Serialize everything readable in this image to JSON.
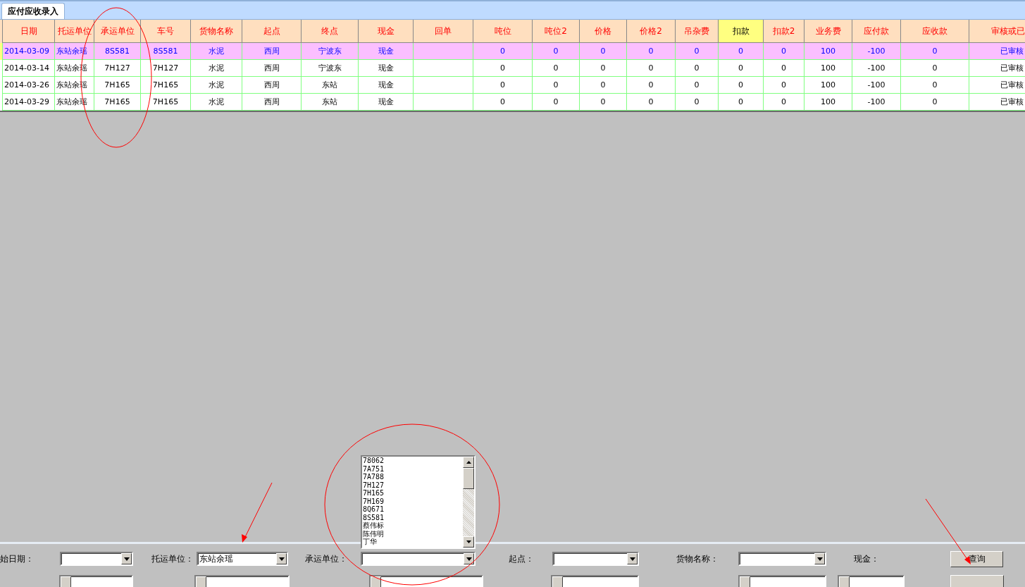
{
  "tab": {
    "label": "应付应收录入",
    "selected": true
  },
  "table": {
    "columns": [
      {
        "label": "日期",
        "highlighted": false
      },
      {
        "label": "托运单位",
        "highlighted": false
      },
      {
        "label": "承运单位",
        "highlighted": false
      },
      {
        "label": "车号",
        "highlighted": false
      },
      {
        "label": "货物名称",
        "highlighted": false
      },
      {
        "label": "起点",
        "highlighted": false
      },
      {
        "label": "终点",
        "highlighted": false
      },
      {
        "label": "现金",
        "highlighted": false
      },
      {
        "label": "回单",
        "highlighted": false
      },
      {
        "label": "吨位",
        "highlighted": false
      },
      {
        "label": "吨位2",
        "highlighted": false
      },
      {
        "label": "价格",
        "highlighted": false
      },
      {
        "label": "价格2",
        "highlighted": false
      },
      {
        "label": "吊杂费",
        "highlighted": false
      },
      {
        "label": "扣款",
        "highlighted": true
      },
      {
        "label": "扣款2",
        "highlighted": false
      },
      {
        "label": "业务费",
        "highlighted": false
      },
      {
        "label": "应付款",
        "highlighted": false
      },
      {
        "label": "应收款",
        "highlighted": false
      },
      {
        "label": "审核或已",
        "highlighted": false
      }
    ],
    "rows": [
      {
        "selected": true,
        "cells": [
          "2014-03-09",
          "东站余瑶",
          "8S581",
          "8S581",
          "水泥",
          "西周",
          "宁波东",
          "现金",
          "",
          "0",
          "0",
          "0",
          "0",
          "0",
          "0",
          "0",
          "100",
          "-100",
          "0",
          "已审核"
        ]
      },
      {
        "selected": false,
        "cells": [
          "2014-03-14",
          "东站余瑶",
          "7H127",
          "7H127",
          "水泥",
          "西周",
          "宁波东",
          "现金",
          "",
          "0",
          "0",
          "0",
          "0",
          "0",
          "0",
          "0",
          "100",
          "-100",
          "0",
          "已审核"
        ]
      },
      {
        "selected": false,
        "cells": [
          "2014-03-26",
          "东站余瑶",
          "7H165",
          "7H165",
          "水泥",
          "西周",
          "东站",
          "现金",
          "",
          "0",
          "0",
          "0",
          "0",
          "0",
          "0",
          "0",
          "100",
          "-100",
          "0",
          "已审核"
        ]
      },
      {
        "selected": false,
        "cells": [
          "2014-03-29",
          "东站余瑶",
          "7H165",
          "7H165",
          "水泥",
          "西周",
          "东站",
          "现金",
          "",
          "0",
          "0",
          "0",
          "0",
          "0",
          "0",
          "0",
          "100",
          "-100",
          "0",
          "已审核"
        ]
      }
    ]
  },
  "filters": [
    {
      "label": "始日期：",
      "kind": "combo",
      "open": false
    },
    {
      "label": "托运单位：",
      "kind": "combo",
      "open": false,
      "value": "东站余瑶"
    },
    {
      "label": "承运单位：",
      "kind": "combo",
      "open": true,
      "dropdown_items": [
        "78062",
        "7A751",
        "7A788",
        "7H127",
        "7H165",
        "7H169",
        "8Q671",
        "8S581",
        "蔡伟标",
        "陈伟明",
        "丁华"
      ]
    },
    {
      "label": "起点：",
      "kind": "combo",
      "open": false
    },
    {
      "label": "货物名称：",
      "kind": "combo",
      "open": false
    },
    {
      "label": "现金：",
      "kind": "label"
    }
  ],
  "query_button": "查询"
}
